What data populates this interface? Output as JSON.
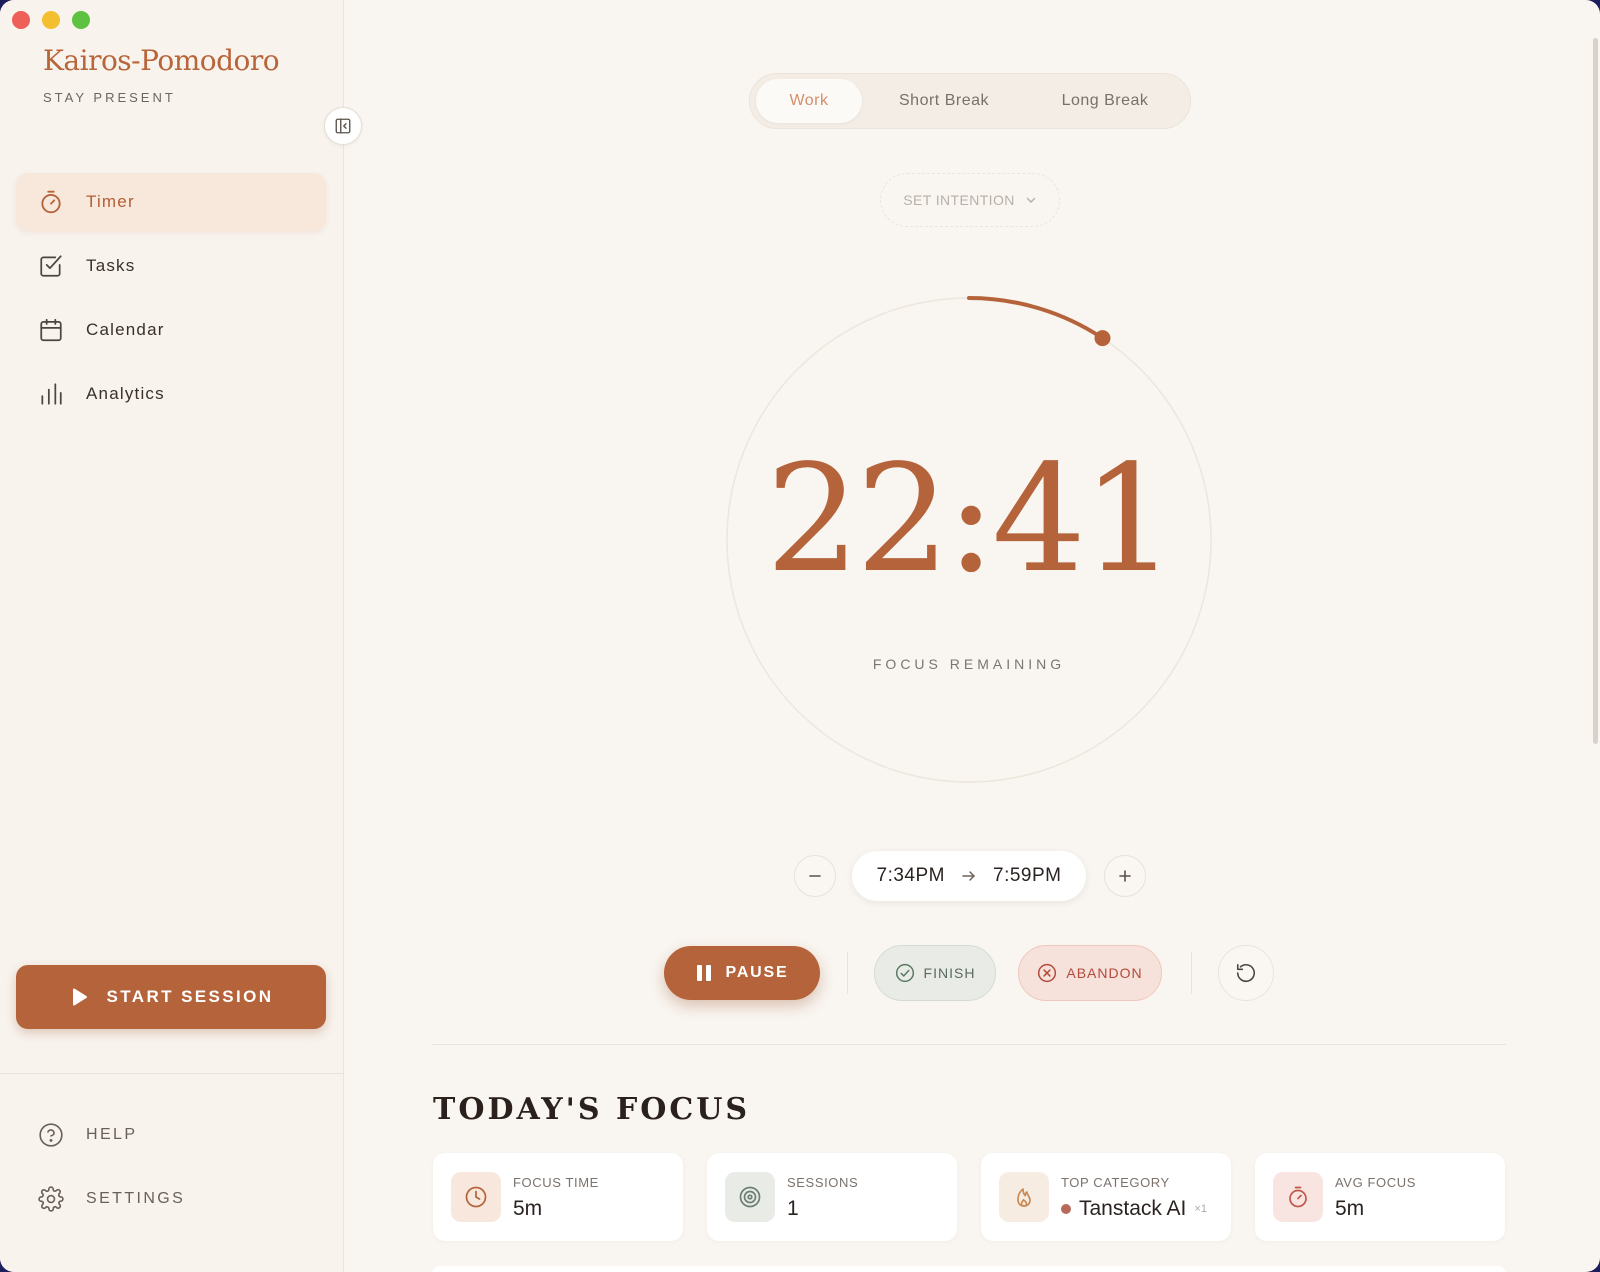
{
  "app": {
    "name": "Kairos-Pomodoro",
    "tagline": "STAY PRESENT",
    "accent": "#b5633a"
  },
  "sidebar": {
    "collapse_icon": "sidebar-collapse-icon",
    "nav": [
      {
        "label": "Timer",
        "icon": "stopwatch-icon",
        "active": true
      },
      {
        "label": "Tasks",
        "icon": "checkbox-icon",
        "active": false
      },
      {
        "label": "Calendar",
        "icon": "calendar-icon",
        "active": false
      },
      {
        "label": "Analytics",
        "icon": "bar-chart-icon",
        "active": false
      }
    ],
    "start_session": "START SESSION",
    "help": "HELP",
    "settings": "SETTINGS"
  },
  "timer": {
    "modes": [
      "Work",
      "Short Break",
      "Long Break"
    ],
    "active_mode": "Work",
    "intention_placeholder": "SET INTENTION",
    "time_remaining": "22:41",
    "remaining_label": "FOCUS REMAINING",
    "progress_fraction": 0.093,
    "start_time": "7:34PM",
    "end_time": "7:59PM",
    "actions": {
      "pause": "PAUSE",
      "finish": "FINISH",
      "abandon": "ABANDON"
    }
  },
  "today": {
    "title": "TODAY'S FOCUS",
    "stats": [
      {
        "label": "FOCUS TIME",
        "value": "5m",
        "icon": "clock-icon"
      },
      {
        "label": "SESSIONS",
        "value": "1",
        "icon": "target-icon"
      },
      {
        "label": "TOP CATEGORY",
        "value": "Tanstack AI",
        "count": "×1",
        "icon": "flame-icon"
      },
      {
        "label": "AVG FOCUS",
        "value": "5m",
        "icon": "stopwatch-icon"
      }
    ]
  }
}
